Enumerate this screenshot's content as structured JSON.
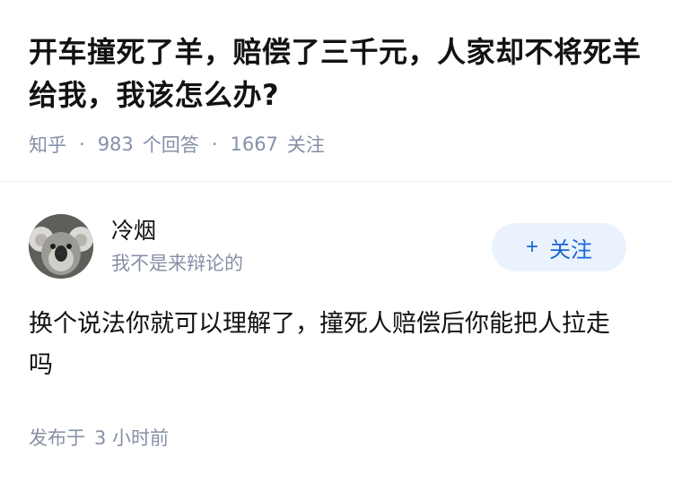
{
  "question": {
    "title": "开车撞死了羊，赔偿了三千元，人家却不将死羊给我，我该怎么办?",
    "source": "知乎",
    "answers_count": "983",
    "answers_label": "个回答",
    "followers_count": "1667",
    "followers_label": "关注"
  },
  "answer": {
    "author_name": "冷烟",
    "author_bio": "我不是来辩论的",
    "avatar_icon": "koala-avatar-icon",
    "follow_button": {
      "plus": "+",
      "label": "关注"
    },
    "content": "换个说法你就可以理解了，撞死人赔偿后你能把人拉走吗",
    "published_label": "发布于",
    "published_time": "3 小时前"
  },
  "colors": {
    "meta_gray": "#8590a6",
    "follow_bg": "#eaf2fd",
    "follow_text": "#1766d8"
  }
}
